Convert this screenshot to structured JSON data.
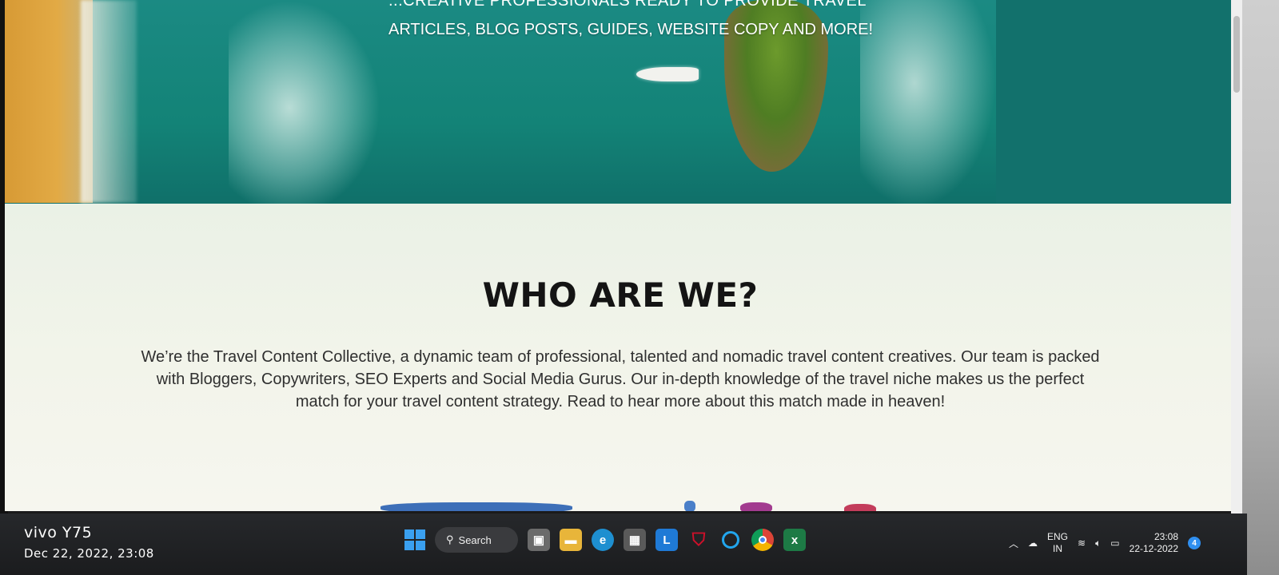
{
  "hero": {
    "tagline_top": "...CREATIVE PROFESSIONALS READY TO PROVIDE TRAVEL",
    "tagline": "ARTICLES, BLOG POSTS, GUIDES, WEBSITE COPY AND MORE!"
  },
  "about": {
    "title": "WHO ARE WE?",
    "paragraph": "We’re the Travel Content Collective, a dynamic team of professional, talented and nomadic travel content creatives. Our team is packed with Bloggers, Copywriters, SEO Experts and Social Media Gurus. Our in-depth knowledge of the travel niche makes us the perfect match for your travel content strategy. Read to hear more about this match made in heaven!"
  },
  "taskbar": {
    "search_label": "Search",
    "apps": [
      {
        "name": "task-view",
        "icon": "task-view-icon",
        "color": "#8a8a8a"
      },
      {
        "name": "file-explorer",
        "icon": "folder-icon",
        "color": "#f2c13a"
      },
      {
        "name": "edge",
        "icon": "edge-icon",
        "color": "#1e90c8"
      },
      {
        "name": "store",
        "icon": "store-icon",
        "color": "#6b6b6b"
      },
      {
        "name": "app-l",
        "label": "L",
        "icon": "l-app-icon",
        "color": "#1f7ad6"
      },
      {
        "name": "mcafee",
        "icon": "mcafee-icon",
        "color": "#c8102e"
      },
      {
        "name": "cortana",
        "icon": "cortana-icon",
        "color": "#1fa3e8"
      },
      {
        "name": "chrome",
        "icon": "chrome-icon",
        "color": "#f2b233"
      },
      {
        "name": "excel",
        "label": "x",
        "icon": "excel-icon",
        "color": "#1d7a45"
      }
    ],
    "tray": {
      "lang": "ENG",
      "region": "IN",
      "time": "23:08",
      "date": "22-12-2022",
      "notifications": "4"
    }
  },
  "watermark": {
    "model": "vivo Y75",
    "datetime": "Dec 22, 2022, 23:08"
  }
}
